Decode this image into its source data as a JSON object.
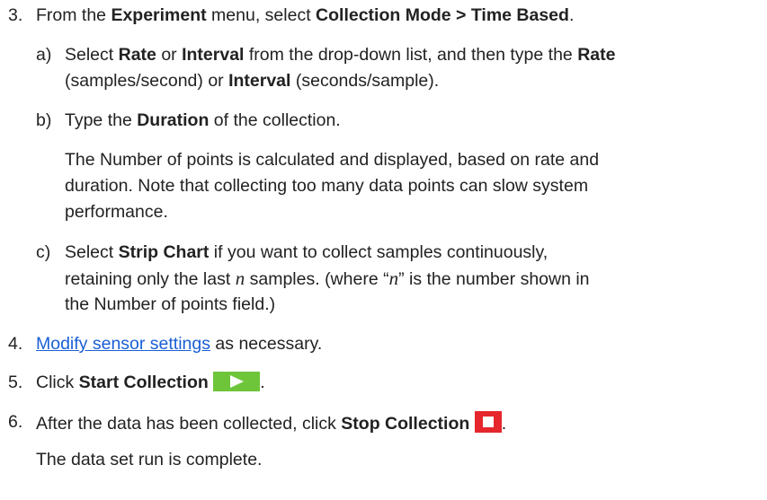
{
  "step3": {
    "number": "3.",
    "t1": "From the ",
    "b1": "Experiment",
    "t2": " menu, select ",
    "b2": "Collection Mode > Time Based",
    "t3": ".",
    "a": {
      "letter": "a)",
      "l1_t1": "Select ",
      "l1_b1": "Rate",
      "l1_t2": " or ",
      "l1_b2": "Interval",
      "l1_t3": " from the drop-down list, and then type the ",
      "l1_b3": "Rate",
      "l2_t1": "(samples/second) or ",
      "l2_b1": "Interval",
      "l2_t2": " (seconds/sample)."
    },
    "b": {
      "letter": "b)",
      "t1": "Type the ",
      "b1": "Duration",
      "t2": " of the collection.",
      "note_l1": "The Number of points is calculated and displayed, based on rate and",
      "note_l2": "duration. Note that collecting too many data points can slow system",
      "note_l3": "performance."
    },
    "c": {
      "letter": "c)",
      "l1_t1": "Select ",
      "l1_b1": "Strip Chart",
      "l1_t2": " if you want to collect samples continuously,",
      "l2_t1": "retaining only the last ",
      "l2_var": "n",
      "l2_t2": " samples. (where “",
      "l2_var2": "n",
      "l2_t3": "” is the number shown in",
      "l3": "the Number of points field.)"
    }
  },
  "step4": {
    "number": "4.",
    "link": "Modify sensor settings",
    "t1": " as necessary."
  },
  "step5": {
    "number": "5.",
    "t1": "Click ",
    "b1": "Start Collection",
    "t2": "."
  },
  "step6": {
    "number": "6.",
    "t1": "After the data has been collected, click ",
    "b1": "Stop Collection",
    "t2": ".",
    "result": "The data set run is complete."
  },
  "icons": {
    "start_icon": "play-icon",
    "stop_icon": "stop-icon",
    "start_color": "#6ec53a",
    "stop_color": "#e5272d"
  }
}
